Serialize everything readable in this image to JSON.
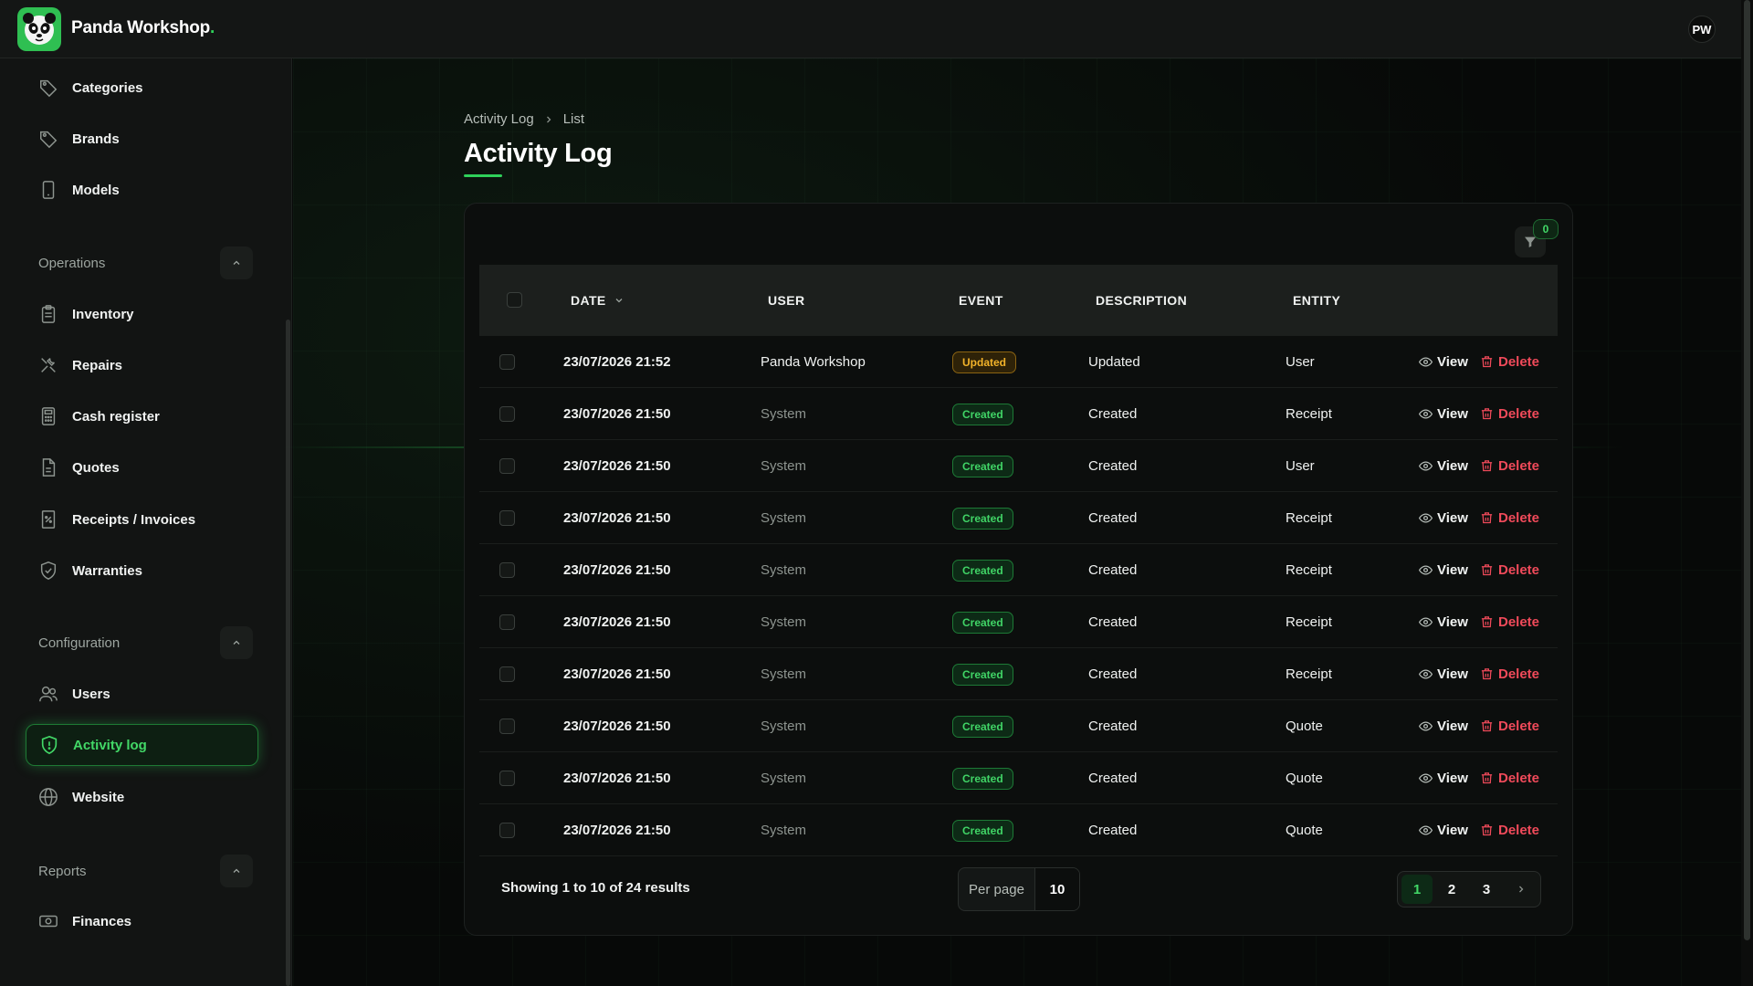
{
  "app": {
    "brand": "Panda Workshop",
    "brand_dot": ".",
    "user_initials": "PW"
  },
  "sidebar": {
    "items_top": [
      {
        "label": "Categories",
        "icon": "tag-icon"
      },
      {
        "label": "Brands",
        "icon": "tag-icon"
      },
      {
        "label": "Models",
        "icon": "phone-icon"
      }
    ],
    "groups": {
      "operations": "Operations",
      "configuration": "Configuration",
      "reports": "Reports"
    },
    "operations_items": [
      {
        "label": "Inventory",
        "icon": "clipboard-icon"
      },
      {
        "label": "Repairs",
        "icon": "tools-icon"
      },
      {
        "label": "Cash register",
        "icon": "calculator-icon"
      },
      {
        "label": "Quotes",
        "icon": "document-icon"
      },
      {
        "label": "Receipts / Invoices",
        "icon": "receipt-icon"
      },
      {
        "label": "Warranties",
        "icon": "shield-check-icon"
      }
    ],
    "configuration_items": [
      {
        "label": "Users",
        "icon": "users-icon"
      },
      {
        "label": "Activity log",
        "icon": "shield-icon",
        "active": true
      },
      {
        "label": "Website",
        "icon": "globe-icon"
      }
    ],
    "reports_items": [
      {
        "label": "Finances",
        "icon": "banknote-icon"
      }
    ]
  },
  "breadcrumb": {
    "parent": "Activity Log",
    "current": "List"
  },
  "page_title": "Activity Log",
  "filter": {
    "count": "0"
  },
  "table": {
    "columns": {
      "date": "DATE",
      "user": "USER",
      "event": "EVENT",
      "description": "DESCRIPTION",
      "entity": "ENTITY"
    },
    "actions": {
      "view": "View",
      "delete": "Delete"
    },
    "rows": [
      {
        "date": "23/07/2026 21:52",
        "user": "Panda Workshop",
        "event": "Updated",
        "description": "Updated",
        "entity": "User"
      },
      {
        "date": "23/07/2026 21:50",
        "user": "System",
        "event": "Created",
        "description": "Created",
        "entity": "Receipt"
      },
      {
        "date": "23/07/2026 21:50",
        "user": "System",
        "event": "Created",
        "description": "Created",
        "entity": "User"
      },
      {
        "date": "23/07/2026 21:50",
        "user": "System",
        "event": "Created",
        "description": "Created",
        "entity": "Receipt"
      },
      {
        "date": "23/07/2026 21:50",
        "user": "System",
        "event": "Created",
        "description": "Created",
        "entity": "Receipt"
      },
      {
        "date": "23/07/2026 21:50",
        "user": "System",
        "event": "Created",
        "description": "Created",
        "entity": "Receipt"
      },
      {
        "date": "23/07/2026 21:50",
        "user": "System",
        "event": "Created",
        "description": "Created",
        "entity": "Receipt"
      },
      {
        "date": "23/07/2026 21:50",
        "user": "System",
        "event": "Created",
        "description": "Created",
        "entity": "Quote"
      },
      {
        "date": "23/07/2026 21:50",
        "user": "System",
        "event": "Created",
        "description": "Created",
        "entity": "Quote"
      },
      {
        "date": "23/07/2026 21:50",
        "user": "System",
        "event": "Created",
        "description": "Created",
        "entity": "Quote"
      }
    ]
  },
  "footer": {
    "showing": "Showing 1 to 10 of 24 results",
    "per_page_label": "Per page",
    "per_page_value": "10",
    "pages": [
      "1",
      "2",
      "3"
    ]
  },
  "colors": {
    "accent": "#2fd15a",
    "danger": "#f04a5a",
    "warning": "#f2b32a"
  }
}
